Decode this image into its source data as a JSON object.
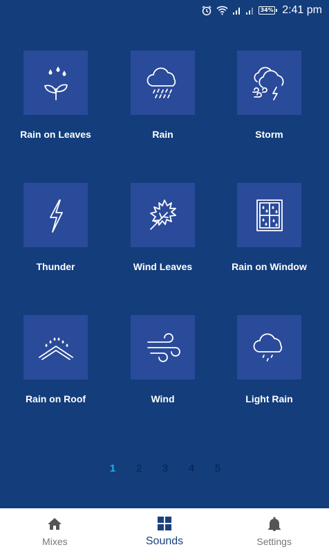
{
  "status_bar": {
    "battery": "34%",
    "time": "2:41 pm"
  },
  "sounds": [
    {
      "label": "Rain on Leaves",
      "icon": "rain-on-leaves-icon"
    },
    {
      "label": "Rain",
      "icon": "rain-cloud-icon"
    },
    {
      "label": "Storm",
      "icon": "storm-cloud-icon"
    },
    {
      "label": "Thunder",
      "icon": "lightning-bolt-icon"
    },
    {
      "label": "Wind Leaves",
      "icon": "maple-leaf-icon"
    },
    {
      "label": "Rain on Window",
      "icon": "window-rain-icon"
    },
    {
      "label": "Rain on Roof",
      "icon": "roof-rain-icon"
    },
    {
      "label": "Wind",
      "icon": "wind-icon"
    },
    {
      "label": "Light Rain",
      "icon": "light-rain-cloud-icon"
    }
  ],
  "pagination": {
    "pages": [
      "1",
      "2",
      "3",
      "4",
      "5"
    ],
    "current": "1"
  },
  "bottom_nav": {
    "items": [
      {
        "label": "Mixes",
        "icon": "home-icon"
      },
      {
        "label": "Sounds",
        "icon": "grid-icon",
        "active": true
      },
      {
        "label": "Settings",
        "icon": "bell-icon"
      }
    ]
  },
  "colors": {
    "background": "#133d7b",
    "tile": "#2a4a9a",
    "active_page": "#1fb0e8",
    "active_nav": "#1a3f7d"
  }
}
